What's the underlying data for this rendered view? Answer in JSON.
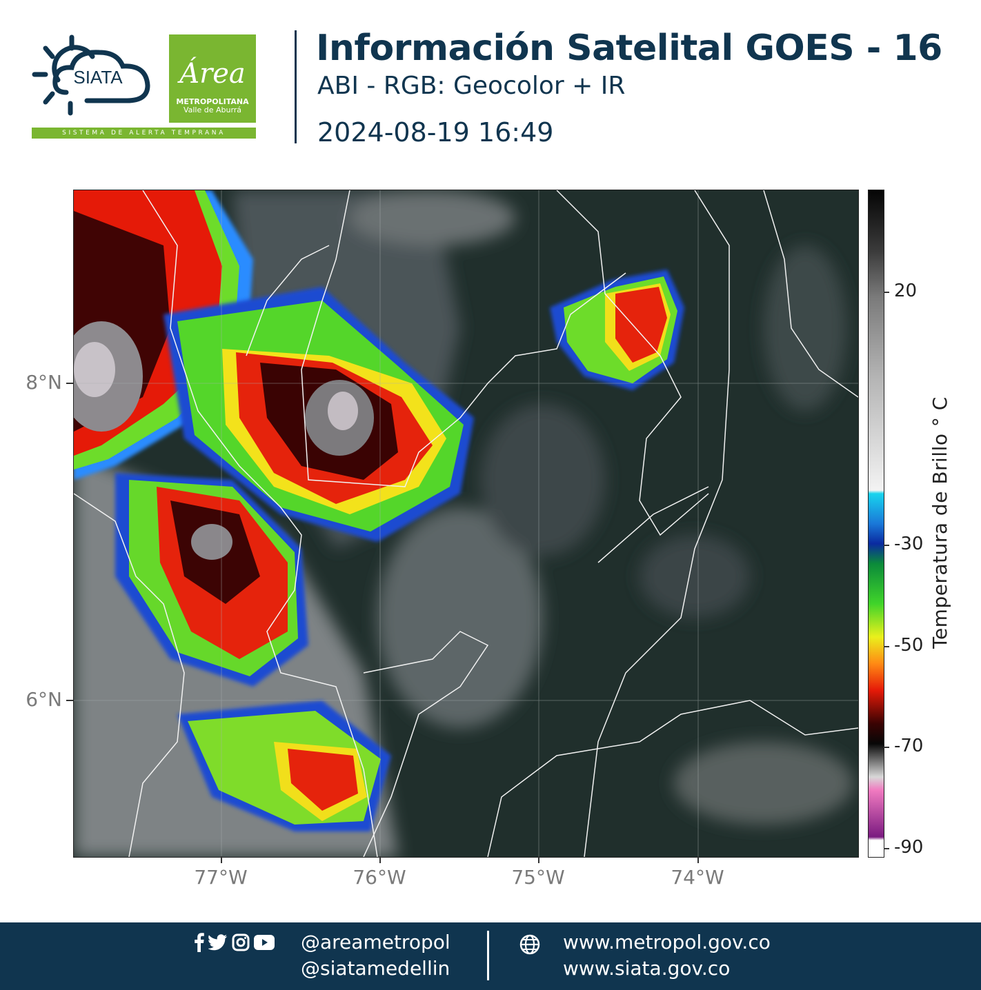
{
  "header": {
    "title": "Información Satelital GOES - 16",
    "subtitle": "ABI - RGB: Geocolor + IR",
    "timestamp": "2024-08-19 16:49",
    "siata_logo_text": "SIATA",
    "siata_tagline": "SISTEMA DE ALERTA TEMPRANA",
    "area_logo_word": "Área",
    "area_logo_line1": "METROPOLITANA",
    "area_logo_line2": "Valle de Aburrá",
    "brand_color": "#10354f",
    "accent_color": "#7ab631"
  },
  "map": {
    "lat_labels": [
      "8°N",
      "6°N"
    ],
    "lon_labels": [
      "77°W",
      "76°W",
      "75°W",
      "74°W"
    ]
  },
  "colorbar": {
    "title": "Temperatura de Brillo  ° C",
    "ticks": [
      "20",
      "-30",
      "-50",
      "-70",
      "-90"
    ]
  },
  "footer": {
    "handle1": "@areametropol",
    "handle2": "@siatamedellin",
    "site1": "www.metropol.gov.co",
    "site2": "www.siata.gov.co",
    "social_icons": [
      "facebook-icon",
      "twitter-icon",
      "instagram-icon",
      "youtube-icon"
    ],
    "web_icon": "globe-icon"
  }
}
